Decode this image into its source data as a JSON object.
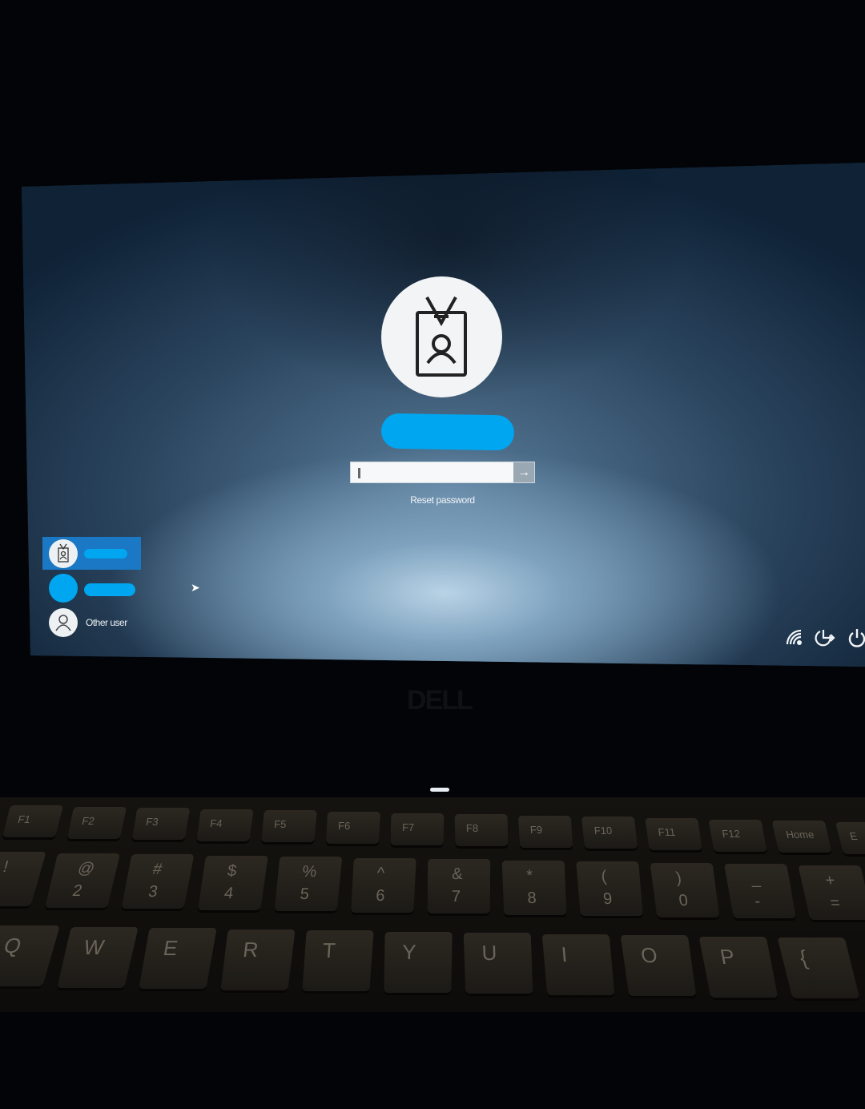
{
  "login": {
    "password_placeholder": "",
    "submit_icon": "arrow-right-icon",
    "reset_password_label": "Reset password",
    "username_redacted": true
  },
  "users": [
    {
      "name": "",
      "selected": true,
      "avatar_icon": "id-badge-icon",
      "redacted": true
    },
    {
      "name": "",
      "selected": false,
      "avatar_icon": "redacted",
      "redacted": true
    },
    {
      "name": "Other user",
      "selected": false,
      "avatar_icon": "person-icon"
    }
  ],
  "system_icons": [
    "network-icon",
    "ease-of-access-icon",
    "power-icon"
  ],
  "bezel": {
    "logo": "DELL"
  },
  "keyboard": {
    "function_row": [
      "F1",
      "F2",
      "F3",
      "F4",
      "F5",
      "F6",
      "F7",
      "F8",
      "F9",
      "F10",
      "F11",
      "F12",
      "Home",
      "E"
    ],
    "number_row": [
      {
        "shift": "!",
        "main": ""
      },
      {
        "shift": "@",
        "main": "2"
      },
      {
        "shift": "#",
        "main": "3"
      },
      {
        "shift": "$",
        "main": "4"
      },
      {
        "shift": "%",
        "main": "5"
      },
      {
        "shift": "^",
        "main": "6"
      },
      {
        "shift": "&",
        "main": "7"
      },
      {
        "shift": "*",
        "main": "8"
      },
      {
        "shift": "(",
        "main": "9"
      },
      {
        "shift": ")",
        "main": "0"
      },
      {
        "shift": "_",
        "main": "-"
      },
      {
        "shift": "+",
        "main": "="
      }
    ],
    "letter_row": [
      "Q",
      "W",
      "E",
      "R",
      "T",
      "Y",
      "U",
      "I",
      "O",
      "P",
      "{"
    ]
  },
  "colors": {
    "accent": "#1b78c4",
    "redaction": "#00a6f0"
  }
}
